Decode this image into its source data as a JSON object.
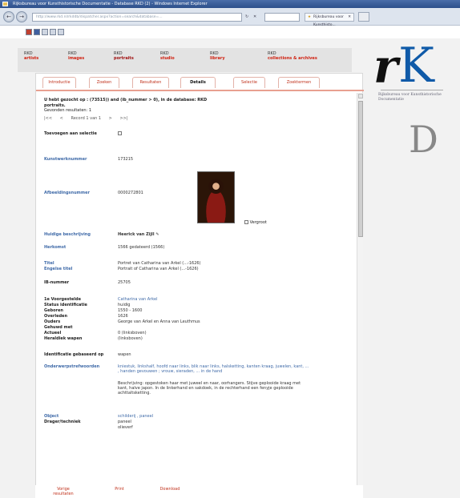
{
  "browser": {
    "title": "Rijksbureau voor Kunsthistorische Documentatie - Database RKD (2) - Windows Internet Explorer",
    "address": "http://www.rkd.nl/rkddb/dispatcher.aspx?action=search&database=...",
    "tab_title": "Rijksbureau voor Kunsthisto..."
  },
  "modules": [
    {
      "prefix": "RKD",
      "name": "artists"
    },
    {
      "prefix": "RKD",
      "name": "images"
    },
    {
      "prefix": "RKD",
      "name": "portraits"
    },
    {
      "prefix": "RKD",
      "name": "studio"
    },
    {
      "prefix": "RKD",
      "name": "library"
    },
    {
      "prefix": "RKD",
      "name": "collections & archives"
    }
  ],
  "logo": {
    "r": "r",
    "k": "K",
    "d": "D",
    "text": "Rijksbureau voor Kunsthistorische Documentatie"
  },
  "tabs": [
    "Introductie",
    "Zoeken",
    "Resultaten",
    "Details",
    "Selectie",
    "Zoektermen"
  ],
  "query": {
    "line1": "U hebt gezocht op : (73515)) and (ib_nummer > 0), in de database: RKD",
    "line2": "portraits.",
    "line3": "Gevonden resultaten: 1"
  },
  "pager": {
    "first": "|<<",
    "prev": "<",
    "record": "Record 1 van 1",
    "next": ">",
    "last": ">>|"
  },
  "fields": {
    "select_label": "Toevoegen aan selectie",
    "kunstwerk_label": "Kunstwerknummer",
    "kunstwerk_value": "173215",
    "afbeelding_label": "Afbeeldingsnummer",
    "afbeelding_value": "0000272801",
    "vergroot": "Vergroot",
    "huidige_label": "Huidige beschrijving",
    "huidige_value": "Heerick van Zijll",
    "herkomst_label": "Herkomst",
    "herkomst_value": "1566 gedateerd (1566)",
    "titel_label": "Titel",
    "titel_value": "Portret van Catharina van Arkel (...-1626)",
    "engelse_label": "Engelse titel",
    "engelse_value": "Portrait of Catharina van Arkel (...-1626)",
    "ib_label": "IB-nummer",
    "ib_value": "25705",
    "voorgesteld_label": "1e Voorgestelde",
    "voorgesteld_value": "Catharina van Arkel",
    "status_label": "Status identificatie",
    "status_value": "huidig",
    "geboren_label": "Geboren",
    "geboren_value": "1550 - 1600",
    "overleden_label": "Overleden",
    "overleden_value": "1626",
    "ouders_label": "Ouders",
    "ouders_value": "George van Arkel en Anna van Leuthmus",
    "gehuwd_label": "Gehuwd met",
    "gehuwd_value": "",
    "actualiteit_label": "Actueel",
    "actualiteit_value": "0 (linksboven)",
    "heraldiek_label": "Heraldiek wapen",
    "heraldiek_value": "(linksboven)",
    "identificatie_label": "Identificatie gebaseerd op",
    "identificatie_value": "wapen",
    "onderwerp_label": "Onderwerpstrefwoorden",
    "onderwerp_value": "kniestuk, linkshalf, hoofd naar links, blik naar links, halsketting, kanten kraag, juwelen, kant, ... , handen gevouwen ; vrouw, sieraden, ... in de hand",
    "beschrijving_value": "Beschrijving: opgestoken haar met juweel en naar, oorhangers. Stijve geplooide kraag met kant, halve japon. In de linkerhand en sakdoek, in de rechterhand een fenyje geplooide achttaltsketting.",
    "object_label": "Object",
    "object_value": "schilderij , paneel",
    "drager_label": "Drager/techniek",
    "drager_value": "paneel",
    "drager_value2": "olieverf"
  },
  "footer": {
    "prev": "Vorige resultaten",
    "print": "Print",
    "download": "Download"
  }
}
